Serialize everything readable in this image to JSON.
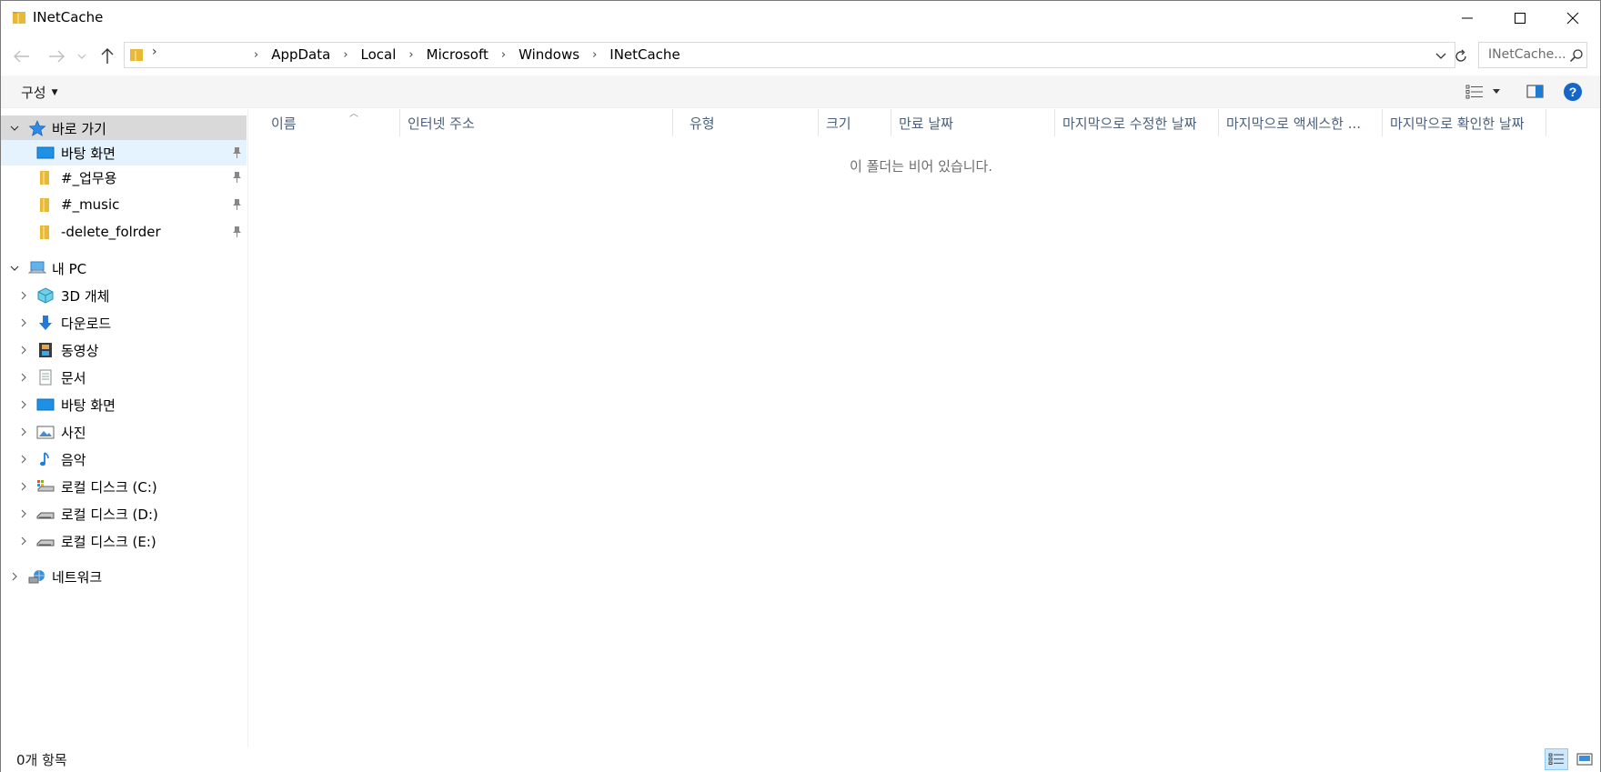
{
  "window": {
    "title": "INetCache"
  },
  "address": {
    "crumbs": [
      "AppData",
      "Local",
      "Microsoft",
      "Windows",
      "INetCache"
    ],
    "first_chevron": "›"
  },
  "search": {
    "placeholder": "INetCache..."
  },
  "toolbar": {
    "organize_label": "구성"
  },
  "navpane": {
    "quick_access": {
      "label": "바로 가기",
      "items": [
        {
          "label": "바탕 화면",
          "icon": "desktop-icon",
          "pinned": true
        },
        {
          "label": "#_업무용",
          "icon": "folder-icon",
          "pinned": true
        },
        {
          "label": "#_music",
          "icon": "folder-icon",
          "pinned": true
        },
        {
          "label": "-delete_folrder",
          "icon": "folder-icon",
          "pinned": true
        }
      ]
    },
    "this_pc": {
      "label": "내 PC",
      "items": [
        {
          "label": "3D 개체",
          "icon": "3d-objects-icon"
        },
        {
          "label": "다운로드",
          "icon": "download-icon"
        },
        {
          "label": "동영상",
          "icon": "video-icon"
        },
        {
          "label": "문서",
          "icon": "document-icon"
        },
        {
          "label": "바탕 화면",
          "icon": "desktop-icon"
        },
        {
          "label": "사진",
          "icon": "picture-icon"
        },
        {
          "label": "음악",
          "icon": "music-icon"
        },
        {
          "label": "로컬 디스크 (C:)",
          "icon": "system-drive-icon"
        },
        {
          "label": "로컬 디스크 (D:)",
          "icon": "drive-icon"
        },
        {
          "label": "로컬 디스크 (E:)",
          "icon": "drive-icon"
        }
      ]
    },
    "network": {
      "label": "네트워크"
    }
  },
  "columns": [
    "이름",
    "인터넷 주소",
    "유형",
    "크기",
    "만료 날짜",
    "마지막으로 수정한 날짜",
    "마지막으로 액세스한 ...",
    "마지막으로 확인한 날짜"
  ],
  "content": {
    "empty_message": "이 폴더는 비어 있습니다."
  },
  "status": {
    "item_count": "0개 항목"
  },
  "colors": {
    "accent": "#0078d7",
    "selected_bg": "#d9d9d9",
    "hover_bg": "#e5f3ff",
    "header_text": "#4c607a"
  }
}
